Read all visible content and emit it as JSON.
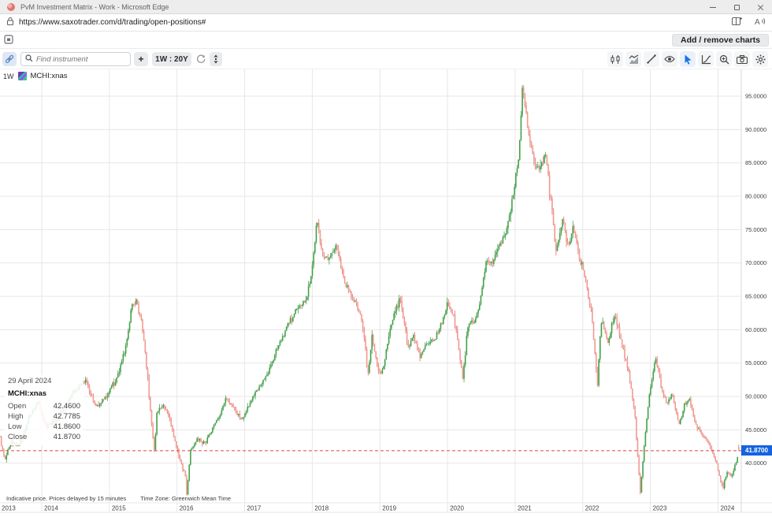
{
  "browser": {
    "title": "PvM Investment Matrix - Work - Microsoft Edge",
    "url": "https://www.saxotrader.com/d/trading/open-positions#"
  },
  "app_header": {
    "add_remove_button": "Add / remove charts"
  },
  "toolbar": {
    "search_placeholder": "Find instrument",
    "add_button": "+",
    "interval_button": "1W : 20Y"
  },
  "legend": {
    "interval": "1W",
    "instrument": "MCHI:xnas"
  },
  "tooltip": {
    "date": "29 April 2024",
    "symbol": "MCHI:xnas",
    "rows": [
      {
        "label": "Open",
        "value": "42.4600"
      },
      {
        "label": "High",
        "value": "42.7785"
      },
      {
        "label": "Low",
        "value": "41.8600"
      },
      {
        "label": "Close",
        "value": "41.8700"
      }
    ]
  },
  "footer": {
    "disclaimer": "Indicative price. Prices delayed by 15 minutes",
    "timezone": "Time Zone: Greenwich Mean Time"
  },
  "chart_data": {
    "type": "candlestick",
    "instrument": "MCHI:xnas",
    "interval": "1W",
    "range": "20Y",
    "current_price": "41.8700",
    "ylim": [
      34,
      99
    ],
    "grid": true,
    "y_ticks": [
      "95.0000",
      "90.0000",
      "85.0000",
      "80.0000",
      "75.0000",
      "70.0000",
      "65.0000",
      "60.0000",
      "55.0000",
      "50.0000",
      "45.0000",
      "40.0000"
    ],
    "x_ticks": [
      "2013",
      "2014",
      "2015",
      "2016",
      "2017",
      "2018",
      "2019",
      "2020",
      "2021",
      "2022",
      "2023",
      "2024"
    ],
    "t_start": 2013.383,
    "t_end": 2024.314,
    "last_candle": {
      "open": 42.46,
      "high": 42.7785,
      "low": 41.86,
      "close": 41.87
    },
    "colors": {
      "up": "#43a047",
      "up_wick": "#2f8f3f",
      "down": "#f09a92",
      "down_wick": "#e05a50",
      "dashed_line": "#e2453e",
      "badge": "#1562e0",
      "grid": "#e7e7e7",
      "axis": "#d8d8d8"
    },
    "anchors": [
      [
        2013.383,
        44.0
      ],
      [
        2013.45,
        40.3
      ],
      [
        2013.55,
        43.5
      ],
      [
        2013.65,
        42.5
      ],
      [
        2013.8,
        46.5
      ],
      [
        2013.95,
        49.3
      ],
      [
        2014.05,
        45.3
      ],
      [
        2014.2,
        46.5
      ],
      [
        2014.35,
        48.5
      ],
      [
        2014.5,
        51.0
      ],
      [
        2014.65,
        52.3
      ],
      [
        2014.8,
        48.5
      ],
      [
        2014.95,
        50.0
      ],
      [
        2015.1,
        52.5
      ],
      [
        2015.25,
        57.5
      ],
      [
        2015.33,
        63.5
      ],
      [
        2015.4,
        64.3
      ],
      [
        2015.48,
        61.0
      ],
      [
        2015.56,
        53.5
      ],
      [
        2015.63,
        45.0
      ],
      [
        2015.665,
        41.5
      ],
      [
        2015.7,
        47.5
      ],
      [
        2015.8,
        48.5
      ],
      [
        2015.9,
        46.5
      ],
      [
        2016.0,
        42.0
      ],
      [
        2016.08,
        39.5
      ],
      [
        2016.13,
        37.8
      ],
      [
        2016.145,
        35.2
      ],
      [
        2016.2,
        42.0
      ],
      [
        2016.3,
        43.5
      ],
      [
        2016.42,
        43.0
      ],
      [
        2016.52,
        45.0
      ],
      [
        2016.62,
        47.0
      ],
      [
        2016.72,
        49.8
      ],
      [
        2016.85,
        48.0
      ],
      [
        2016.95,
        46.5
      ],
      [
        2017.05,
        48.5
      ],
      [
        2017.2,
        51.0
      ],
      [
        2017.35,
        53.5
      ],
      [
        2017.5,
        57.5
      ],
      [
        2017.65,
        61.0
      ],
      [
        2017.8,
        63.5
      ],
      [
        2017.92,
        64.5
      ],
      [
        2018.0,
        69.0
      ],
      [
        2018.07,
        76.3
      ],
      [
        2018.15,
        71.0
      ],
      [
        2018.25,
        70.5
      ],
      [
        2018.36,
        72.6
      ],
      [
        2018.5,
        66.5
      ],
      [
        2018.62,
        64.5
      ],
      [
        2018.72,
        62.0
      ],
      [
        2018.8,
        55.8
      ],
      [
        2018.82,
        52.5
      ],
      [
        2018.88,
        59.0
      ],
      [
        2018.97,
        54.0
      ],
      [
        2019.03,
        53.5
      ],
      [
        2019.12,
        58.5
      ],
      [
        2019.22,
        62.5
      ],
      [
        2019.3,
        64.8
      ],
      [
        2019.42,
        56.8
      ],
      [
        2019.5,
        59.0
      ],
      [
        2019.6,
        55.8
      ],
      [
        2019.7,
        58.0
      ],
      [
        2019.8,
        58.5
      ],
      [
        2019.9,
        60.5
      ],
      [
        2020.0,
        63.8
      ],
      [
        2020.1,
        61.5
      ],
      [
        2020.2,
        54.8
      ],
      [
        2020.225,
        52.5
      ],
      [
        2020.3,
        60.5
      ],
      [
        2020.42,
        61.5
      ],
      [
        2020.5,
        65.5
      ],
      [
        2020.57,
        70.5
      ],
      [
        2020.67,
        69.8
      ],
      [
        2020.77,
        72.5
      ],
      [
        2020.87,
        75.0
      ],
      [
        2020.97,
        80.0
      ],
      [
        2021.06,
        87.0
      ],
      [
        2021.115,
        97.8
      ],
      [
        2021.14,
        93.5
      ],
      [
        2021.18,
        91.0
      ],
      [
        2021.27,
        85.0
      ],
      [
        2021.37,
        84.5
      ],
      [
        2021.45,
        86.5
      ],
      [
        2021.53,
        79.0
      ],
      [
        2021.6,
        71.8
      ],
      [
        2021.7,
        76.5
      ],
      [
        2021.78,
        72.5
      ],
      [
        2021.86,
        75.0
      ],
      [
        2021.96,
        70.5
      ],
      [
        2022.04,
        67.5
      ],
      [
        2022.12,
        63.0
      ],
      [
        2022.2,
        54.0
      ],
      [
        2022.21,
        50.5
      ],
      [
        2022.27,
        61.5
      ],
      [
        2022.37,
        58.0
      ],
      [
        2022.47,
        62.3
      ],
      [
        2022.58,
        58.0
      ],
      [
        2022.68,
        53.5
      ],
      [
        2022.77,
        47.0
      ],
      [
        2022.83,
        38.5
      ],
      [
        2022.845,
        35.0
      ],
      [
        2022.88,
        39.5
      ],
      [
        2022.93,
        45.0
      ],
      [
        2023.0,
        51.5
      ],
      [
        2023.08,
        55.8
      ],
      [
        2023.16,
        51.5
      ],
      [
        2023.24,
        49.0
      ],
      [
        2023.32,
        50.5
      ],
      [
        2023.42,
        45.5
      ],
      [
        2023.5,
        48.5
      ],
      [
        2023.57,
        49.8
      ],
      [
        2023.66,
        46.0
      ],
      [
        2023.76,
        44.5
      ],
      [
        2023.86,
        43.0
      ],
      [
        2023.96,
        40.5
      ],
      [
        2024.03,
        37.8
      ],
      [
        2024.075,
        36.2
      ],
      [
        2024.08,
        36.9
      ],
      [
        2024.14,
        38.8
      ],
      [
        2024.2,
        38.2
      ],
      [
        2024.26,
        40.2
      ],
      [
        2024.314,
        41.87
      ]
    ]
  }
}
